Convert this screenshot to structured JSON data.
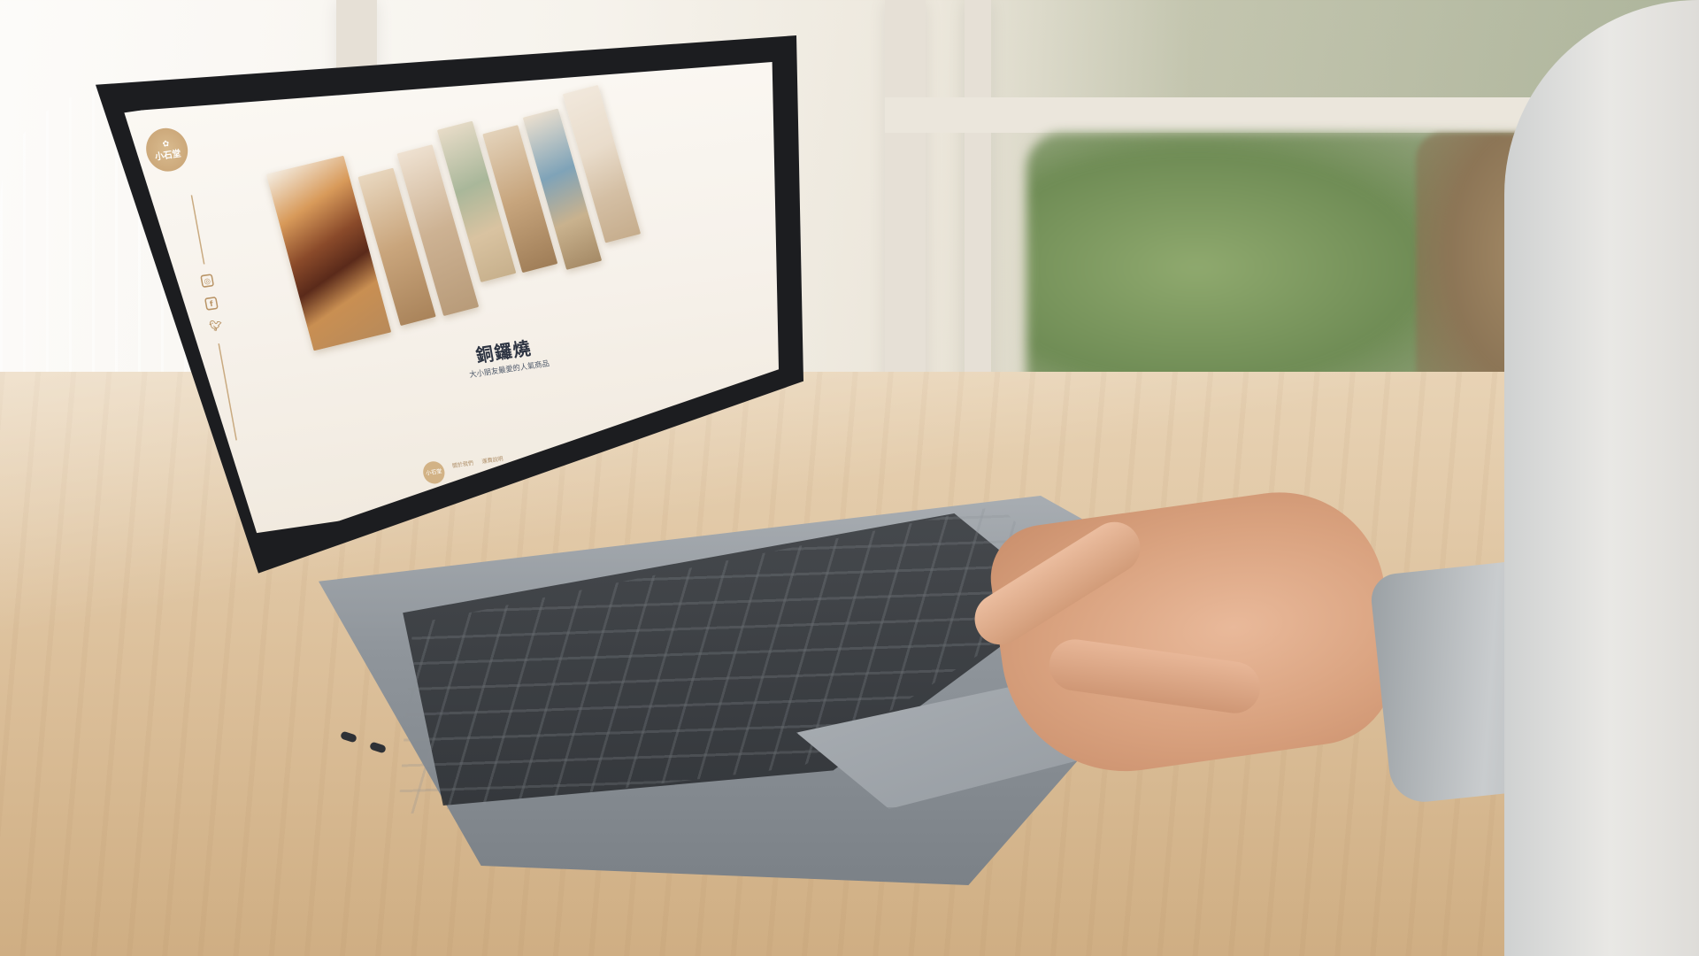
{
  "site": {
    "logo_text": "小石堂",
    "product": {
      "title": "銅鑼燒",
      "subtitle": "大小朋友最愛的人氣商品"
    },
    "footer_links": [
      "關於我們",
      "運費說明"
    ],
    "top_icons": [
      "user-icon",
      "cart-icon",
      "menu-icon"
    ],
    "social_icons": [
      "instagram-icon",
      "facebook-icon",
      "twitter-icon"
    ]
  },
  "colors": {
    "accent": "#c9aa80",
    "title": "#2d3442",
    "screen_bg": "#f8f4ee"
  }
}
